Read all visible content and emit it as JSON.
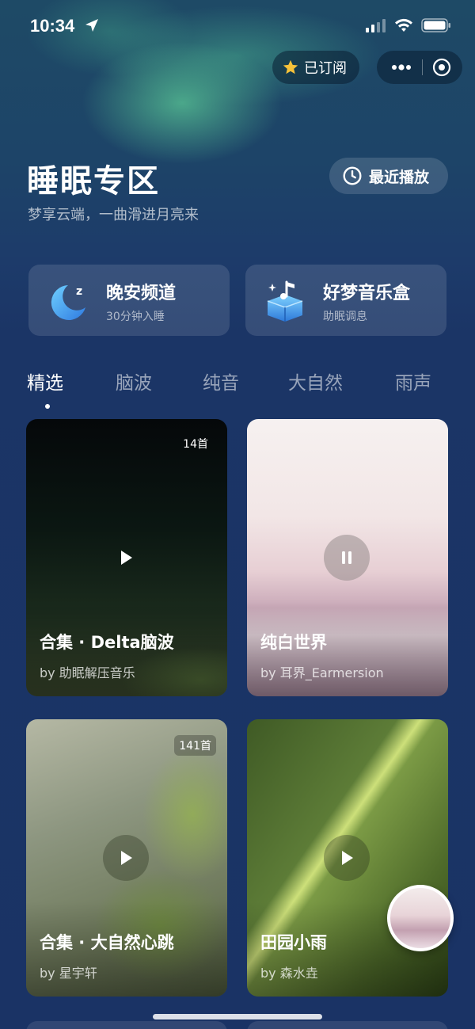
{
  "status_bar": {
    "time": "10:34"
  },
  "header": {
    "subscribe_label": "已订阅",
    "title": "睡眠专区",
    "subtitle": "梦享云端，一曲滑进月亮来",
    "recent_label": "最近播放"
  },
  "quick_cards": [
    {
      "title": "晚安频道",
      "subtitle": "30分钟入睡",
      "icon": "moon-icon"
    },
    {
      "title": "好梦音乐盒",
      "subtitle": "助眠调息",
      "icon": "music-box-icon"
    }
  ],
  "tabs": [
    "精选",
    "脑波",
    "纯音",
    "大自然",
    "雨声"
  ],
  "active_tab": "精选",
  "cards": [
    {
      "count": "14首",
      "title": "合集 · Delta脑波",
      "author": "by 助眠解压音乐",
      "state": "play"
    },
    {
      "count": "",
      "title": "纯白世界",
      "author": "by 耳界_Earmersion",
      "state": "pause"
    },
    {
      "count": "141首",
      "title": "合集 · 大自然心跳",
      "author": "by 星宇轩",
      "state": "play"
    },
    {
      "count": "",
      "title": "田园小雨",
      "author": "by 森水垚",
      "state": "play"
    }
  ],
  "colors": {
    "background": "#1b3566",
    "accent_star": "#f5c23a"
  }
}
